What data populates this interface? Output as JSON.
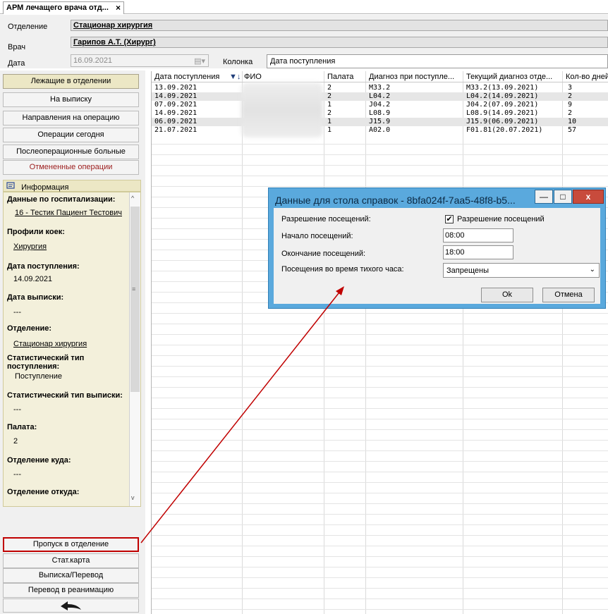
{
  "tab": {
    "title": "АРМ лечащего врача отд...",
    "close": "×"
  },
  "header": {
    "department_label": "Отделение",
    "department_value": "Стационар хирургия",
    "doctor_label": "Врач",
    "doctor_value": "Гарипов А.Т. (Хирург)",
    "date_label": "Дата",
    "date_value": "16.09.2021",
    "column_label": "Колонка",
    "column_value": "Дата поступления"
  },
  "nav_buttons": [
    {
      "label": "Лежащие в отделении"
    },
    {
      "label": "На выписку"
    },
    {
      "label": "Направления на операцию"
    },
    {
      "label": "Операции сегодня"
    },
    {
      "label": "Послеоперационные больные"
    },
    {
      "label": "Отмененные операции"
    }
  ],
  "info": {
    "title": "Информация",
    "fields": [
      {
        "label": "Данные по госпитализации:",
        "value": "16 - Тестик Пациент Тестович"
      },
      {
        "label": "Профили коек:",
        "value": "Хирургия"
      },
      {
        "label": "Дата поступления:",
        "value": "14.09.2021"
      },
      {
        "label": "Дата выписки:",
        "value": "---"
      },
      {
        "label": "Отделение:",
        "value": "Стационар хирургия"
      },
      {
        "label": "Статистический тип поступления:",
        "value": "Поступление"
      },
      {
        "label": "Статистический тип выписки:",
        "value": "---"
      },
      {
        "label": "Палата:",
        "value": "2"
      },
      {
        "label": "Отделение куда:",
        "value": "---"
      },
      {
        "label": "Отделение откуда:",
        "value": ""
      }
    ]
  },
  "bottom_buttons": [
    {
      "label": "Пропуск в отделение"
    },
    {
      "label": "Стат.карта"
    },
    {
      "label": "Выписка/Перевод"
    },
    {
      "label": "Перевод в реанимацию"
    }
  ],
  "grid": {
    "columns": [
      "Дата поступления",
      "ФИО",
      "Палата",
      "Диагноз при поступле...",
      "Текущий диагноз отде...",
      "Кол-во дней"
    ],
    "sort_icon": "▼↓",
    "rows": [
      [
        "13.09.2021",
        "",
        "2",
        "M33.2",
        "M33.2(13.09.2021)",
        "3"
      ],
      [
        "14.09.2021",
        "",
        "2",
        "L04.2",
        "L04.2(14.09.2021)",
        "2"
      ],
      [
        "07.09.2021",
        "",
        "1",
        "J04.2",
        "J04.2(07.09.2021)",
        "9"
      ],
      [
        "14.09.2021",
        "",
        "2",
        "L08.9",
        "L08.9(14.09.2021)",
        "2"
      ],
      [
        "06.09.2021",
        "",
        "1",
        "J15.9",
        "J15.9(06.09.2021)",
        "10"
      ],
      [
        "21.07.2021",
        "",
        "1",
        "A02.0",
        "F01.81(20.07.2021)",
        "57"
      ]
    ]
  },
  "dialog": {
    "title": "Данные для стола справок - 8bfa024f-7aa5-48f8-b5...",
    "minimize": "—",
    "maximize": "□",
    "close": "x",
    "visit_permission_label": "Разрешение посещений:",
    "visit_permission_checkbox_label": "Разрешение посещений",
    "visit_permission_checked": true,
    "start_label": "Начало посещений:",
    "start_value": "08:00",
    "end_label": "Окончание посещений:",
    "end_value": "18:00",
    "quiet_hour_label": "Посещения во время тихого часа:",
    "quiet_hour_value": "Запрещены",
    "ok_label": "Ok",
    "cancel_label": "Отмена"
  },
  "colors": {
    "accent_red": "#c00000",
    "dialog_frame": "#5aa9dd",
    "active_tab": "#ece7c5"
  }
}
